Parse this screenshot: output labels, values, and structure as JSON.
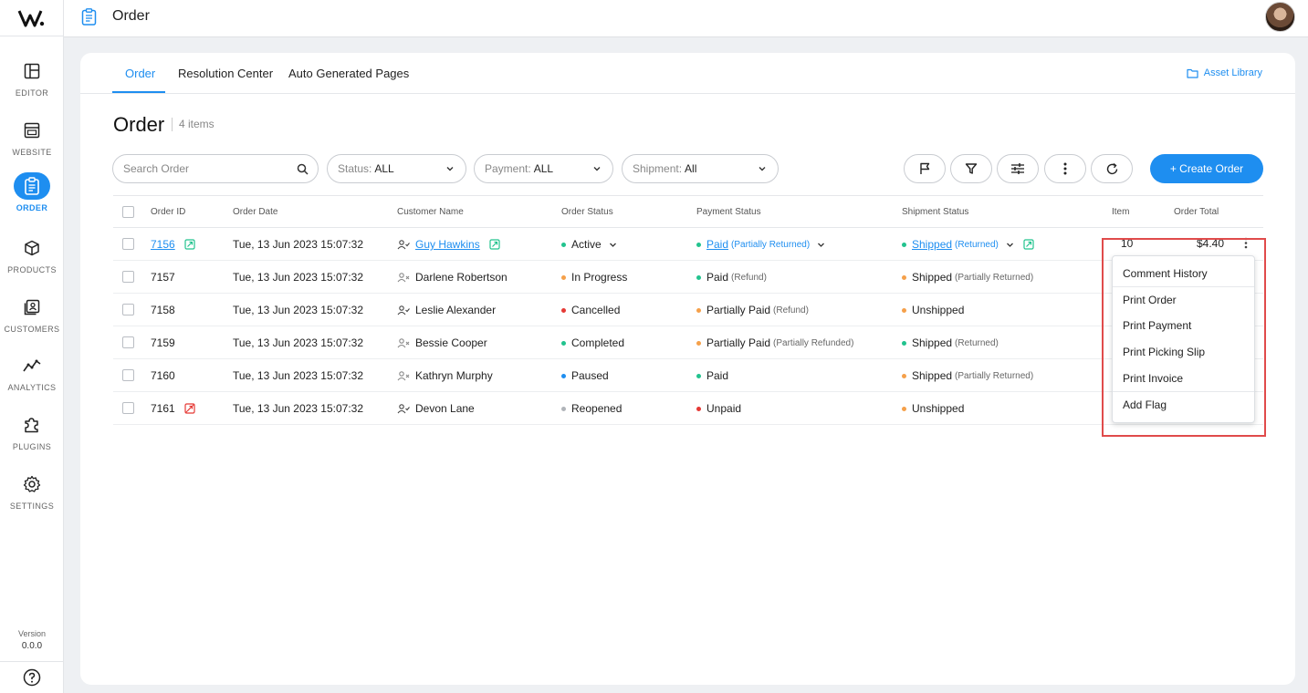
{
  "app": {
    "title": "Order"
  },
  "sidebar": {
    "items": [
      {
        "label": "EDITOR",
        "icon": "layout-icon"
      },
      {
        "label": "WEBSITE",
        "icon": "browser-icon"
      },
      {
        "label": "ORDER",
        "icon": "clipboard-icon"
      },
      {
        "label": "PRODUCTS",
        "icon": "box-icon"
      },
      {
        "label": "CUSTOMERS",
        "icon": "contacts-icon"
      },
      {
        "label": "ANALYTICS",
        "icon": "chart-line-icon"
      },
      {
        "label": "PLUGINS",
        "icon": "puzzle-icon"
      },
      {
        "label": "SETTINGS",
        "icon": "gear-icon"
      }
    ],
    "version_label": "Version",
    "version": "0.0.0"
  },
  "tabs": [
    "Order",
    "Resolution Center",
    "Auto Generated Pages"
  ],
  "asset_library": "Asset Library",
  "page": {
    "title": "Order",
    "count": "4 items"
  },
  "filters": {
    "search_placeholder": "Search Order",
    "status_label": "Status:",
    "status_value": "ALL",
    "payment_label": "Payment:",
    "payment_value": "ALL",
    "shipment_label": "Shipment:",
    "shipment_value": "All"
  },
  "create_button": "+ Create Order",
  "table": {
    "headers": [
      "Order ID",
      "Order Date",
      "Customer Name",
      "Order Status",
      "Payment Status",
      "Shipment Status",
      "Item",
      "Order Total"
    ],
    "rows": [
      {
        "id": "7156",
        "date": "Tue, 13 Jun 2023 15:07:32",
        "customer": "Guy Hawkins",
        "status": "Active",
        "payment": "Paid",
        "payment_sub": "(Partially Returned)",
        "shipment": "Shipped",
        "shipment_sub": "(Returned)",
        "item": "10",
        "total": "$4.40"
      },
      {
        "id": "7157",
        "date": "Tue, 13 Jun 2023 15:07:32",
        "customer": "Darlene Robertson",
        "status": "In Progress",
        "payment": "Paid",
        "payment_sub": "(Refund)",
        "shipment": "Shipped",
        "shipment_sub": "(Partially Returned)"
      },
      {
        "id": "7158",
        "date": "Tue, 13 Jun 2023 15:07:32",
        "customer": "Leslie Alexander",
        "status": "Cancelled",
        "payment": "Partially Paid",
        "payment_sub": "(Refund)",
        "shipment": "Unshipped",
        "shipment_sub": ""
      },
      {
        "id": "7159",
        "date": "Tue, 13 Jun 2023 15:07:32",
        "customer": "Bessie Cooper",
        "status": "Completed",
        "payment": "Partially Paid",
        "payment_sub": "(Partially Refunded)",
        "shipment": "Shipped",
        "shipment_sub": "(Returned)"
      },
      {
        "id": "7160",
        "date": "Tue, 13 Jun 2023 15:07:32",
        "customer": "Kathryn Murphy",
        "status": "Paused",
        "payment": "Paid",
        "payment_sub": "",
        "shipment": "Shipped",
        "shipment_sub": "(Partially Returned)"
      },
      {
        "id": "7161",
        "date": "Tue, 13 Jun 2023 15:07:32",
        "customer": "Devon Lane",
        "status": "Reopened",
        "payment": "Unpaid",
        "payment_sub": "",
        "shipment": "Unshipped",
        "shipment_sub": ""
      }
    ]
  },
  "menu": {
    "items": [
      "Comment History",
      "Print Order",
      "Print Payment",
      "Print Picking Slip",
      "Print Invoice",
      "Add Flag"
    ]
  },
  "colors": {
    "accent": "#1e8ef0",
    "green": "#22c38e",
    "orange": "#f5a04a",
    "red": "#e53935",
    "blue": "#1e8ef0",
    "gray": "#b0b4b9",
    "highlight": "#e04b4b"
  }
}
